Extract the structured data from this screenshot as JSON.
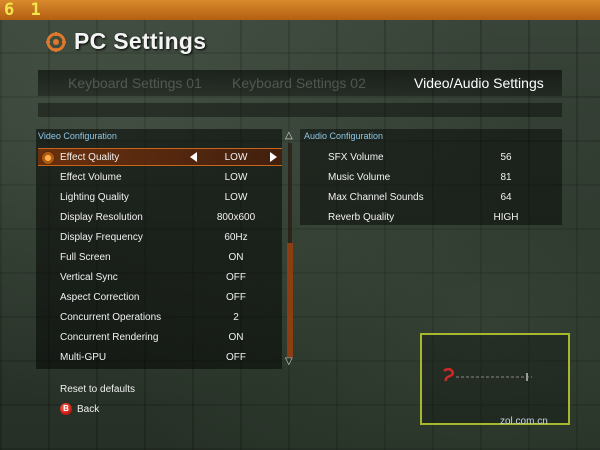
{
  "hud": {
    "fps": "6 1"
  },
  "header": {
    "title": "PC Settings",
    "icon": "gear-icon"
  },
  "tabs": [
    {
      "label": "Keyboard Settings 01",
      "active": false
    },
    {
      "label": "Keyboard Settings 02",
      "active": false
    },
    {
      "label": "Video/Audio Settings",
      "active": true
    }
  ],
  "video": {
    "heading": "Video Configuration",
    "rows": [
      {
        "label": "Effect Quality",
        "value": "LOW",
        "selected": true
      },
      {
        "label": "Effect Volume",
        "value": "LOW"
      },
      {
        "label": "Lighting Quality",
        "value": "LOW"
      },
      {
        "label": "Display Resolution",
        "value": "800x600"
      },
      {
        "label": "Display Frequency",
        "value": "60Hz"
      },
      {
        "label": "Full Screen",
        "value": "ON"
      },
      {
        "label": "Vertical Sync",
        "value": "OFF"
      },
      {
        "label": "Aspect Correction",
        "value": "OFF"
      },
      {
        "label": "Concurrent Operations",
        "value": "2"
      },
      {
        "label": "Concurrent Rendering",
        "value": "ON"
      },
      {
        "label": "Multi-GPU",
        "value": "OFF"
      }
    ]
  },
  "audio": {
    "heading": "Audio Configuration",
    "rows": [
      {
        "label": "SFX Volume",
        "value": "56"
      },
      {
        "label": "Music Volume",
        "value": "81"
      },
      {
        "label": "Max Channel Sounds",
        "value": "64"
      },
      {
        "label": "Reverb Quality",
        "value": "HIGH"
      }
    ]
  },
  "footer": {
    "reset": "Reset to defaults",
    "back_button": "B",
    "back": "Back"
  },
  "watermark": "zol.com.cn",
  "colors": {
    "accent": "#c8641c",
    "section_heading": "#8ec6e6",
    "topbar": "#c8721e",
    "fps": "#f2e64a"
  }
}
